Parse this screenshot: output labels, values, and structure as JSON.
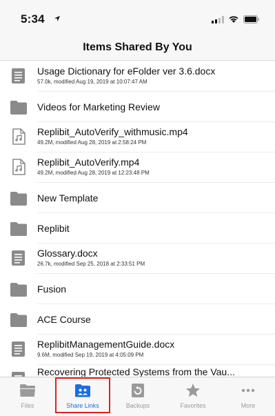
{
  "status": {
    "time": "5:34"
  },
  "nav": {
    "title": "Items Shared By You"
  },
  "items": [
    {
      "type": "document",
      "name": "Usage Dictionary for eFolder ver 3.6.docx",
      "meta": "57.0k, modified Aug 19, 2019 at 10:07:47 AM"
    },
    {
      "type": "folder",
      "name": "Videos for Marketing Review",
      "meta": ""
    },
    {
      "type": "media",
      "name": "Replibit_AutoVerify_withmusic.mp4",
      "meta": "49.2M, modified Aug 28, 2019 at 2:58:24 PM"
    },
    {
      "type": "media",
      "name": "Replibit_AutoVerify.mp4",
      "meta": "49.2M, modified Aug 28, 2019 at 12:23:48 PM"
    },
    {
      "type": "folder",
      "name": "New Template",
      "meta": ""
    },
    {
      "type": "folder",
      "name": "Replibit",
      "meta": ""
    },
    {
      "type": "document",
      "name": "Glossary.docx",
      "meta": "26.7k, modified Sep 25, 2018 at 2:33:51 PM"
    },
    {
      "type": "folder",
      "name": "Fusion",
      "meta": ""
    },
    {
      "type": "folder",
      "name": "ACE Course",
      "meta": ""
    },
    {
      "type": "document",
      "name": "ReplibitManagementGuide.docx",
      "meta": "9.6M, modified Sep 19, 2019 at 4:05:09 PM"
    },
    {
      "type": "document",
      "name": "Recovering Protected Systems from the Vau...",
      "meta": ""
    }
  ],
  "tabs": [
    {
      "label": "Files",
      "icon": "folder-icon",
      "active": false
    },
    {
      "label": "Share Links",
      "icon": "shared-folder-icon",
      "active": true
    },
    {
      "label": "Backups",
      "icon": "backup-icon",
      "active": false
    },
    {
      "label": "Favorites",
      "icon": "star-icon",
      "active": false
    },
    {
      "label": "More",
      "icon": "more-icon",
      "active": false
    }
  ],
  "colors": {
    "accent": "#1a6fe0",
    "icon_gray": "#8a8a8a",
    "highlight_border": "#e02020"
  }
}
